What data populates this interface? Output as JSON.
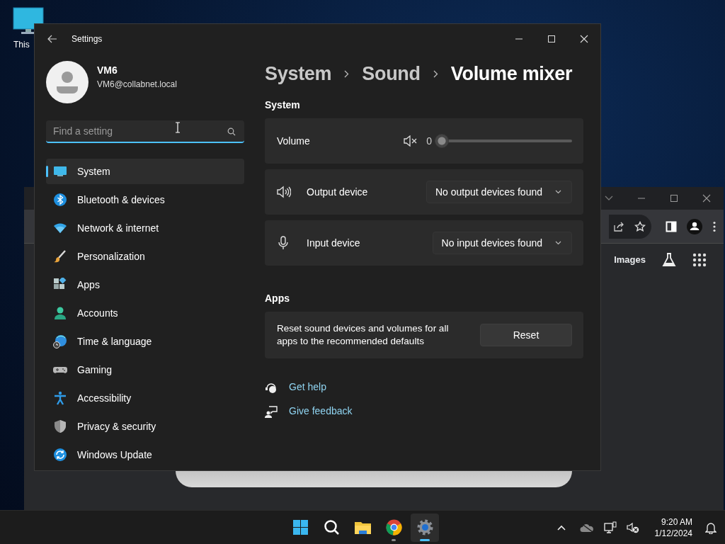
{
  "desktop_icons": [
    {
      "label": "This"
    }
  ],
  "browser_window": {
    "links": [
      "Images"
    ]
  },
  "settings_window": {
    "title": "Settings",
    "user": {
      "name": "VM6",
      "email": "VM6@collabnet.local"
    },
    "search": {
      "placeholder": "Find a setting"
    },
    "nav": [
      {
        "label": "System",
        "kind": "system",
        "selected": true
      },
      {
        "label": "Bluetooth & devices",
        "kind": "bluetooth",
        "selected": false
      },
      {
        "label": "Network & internet",
        "kind": "network",
        "selected": false
      },
      {
        "label": "Personalization",
        "kind": "personalization",
        "selected": false
      },
      {
        "label": "Apps",
        "kind": "apps",
        "selected": false
      },
      {
        "label": "Accounts",
        "kind": "accounts",
        "selected": false
      },
      {
        "label": "Time & language",
        "kind": "time",
        "selected": false
      },
      {
        "label": "Gaming",
        "kind": "gaming",
        "selected": false
      },
      {
        "label": "Accessibility",
        "kind": "accessibility",
        "selected": false
      },
      {
        "label": "Privacy & security",
        "kind": "privacy",
        "selected": false
      },
      {
        "label": "Windows Update",
        "kind": "update",
        "selected": false
      }
    ],
    "breadcrumb": [
      "System",
      "Sound",
      "Volume mixer"
    ],
    "system_section": {
      "heading": "System",
      "volume": {
        "label": "Volume",
        "muted": true,
        "reading": "0",
        "level": 0
      },
      "devices": [
        {
          "kind": "output",
          "label": "Output device",
          "value": "No output devices found"
        },
        {
          "kind": "input",
          "label": "Input device",
          "value": "No input devices found"
        }
      ]
    },
    "apps_section": {
      "heading": "Apps",
      "description": "Reset sound devices and volumes for all apps to the recommended defaults",
      "button": "Reset"
    },
    "links": [
      {
        "kind": "help",
        "label": "Get help"
      },
      {
        "kind": "feedback",
        "label": "Give feedback"
      }
    ]
  },
  "taskbar": {
    "apps": [
      {
        "kind": "start",
        "running": false,
        "selected": false
      },
      {
        "kind": "search",
        "running": false,
        "selected": false
      },
      {
        "kind": "files",
        "running": false,
        "selected": false
      },
      {
        "kind": "chrome",
        "running": true,
        "selected": false
      },
      {
        "kind": "settings",
        "running": true,
        "selected": true
      }
    ],
    "time": "9:20 AM",
    "date": "1/12/2024"
  }
}
